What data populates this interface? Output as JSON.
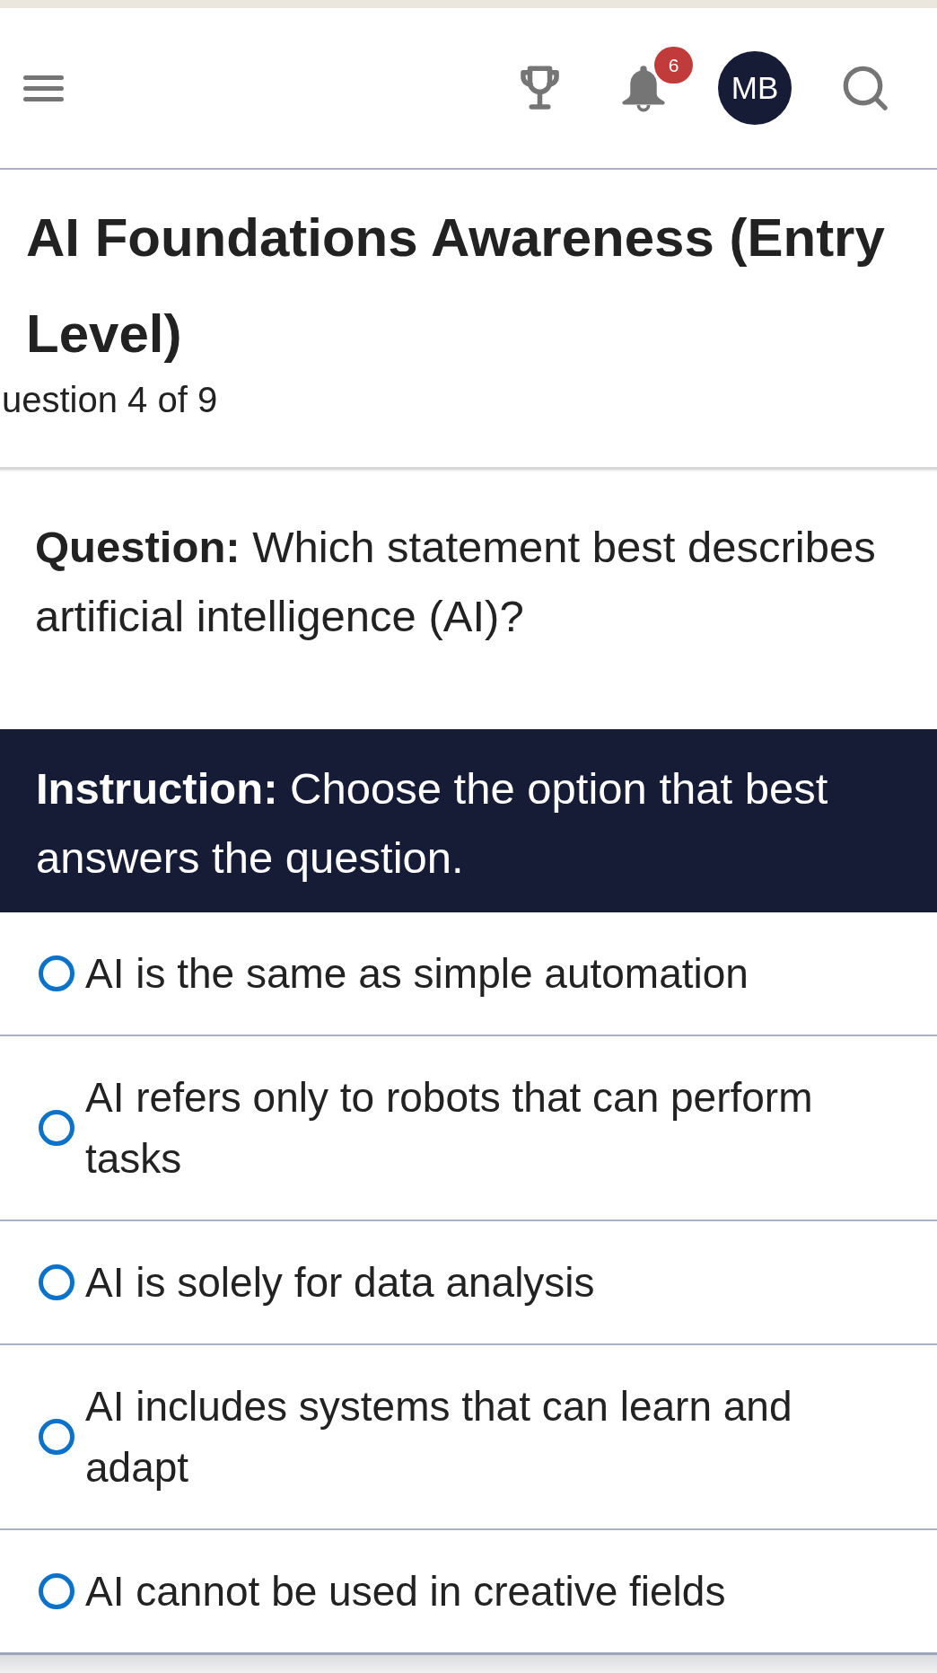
{
  "header": {
    "notification_count": "6",
    "avatar_initials": "MB"
  },
  "quiz": {
    "title": "AI Foundations Awareness (Entry Level)",
    "question_number": "uestion 4 of 9"
  },
  "question": {
    "text": "**Question:** Which statement best describes artificial intelligence (AI)?"
  },
  "instruction": {
    "text": "**Instruction:** Choose the option that best answers the question."
  },
  "options": [
    {
      "label": "AI is the same as simple automation",
      "selected": false
    },
    {
      "label": "AI refers only to robots that can perform tasks",
      "selected": false
    },
    {
      "label": "AI is solely for data analysis",
      "selected": false
    },
    {
      "label": "AI includes systems that can learn and adapt",
      "selected": false
    },
    {
      "label": "AI cannot be used in creative fields",
      "selected": false
    }
  ]
}
